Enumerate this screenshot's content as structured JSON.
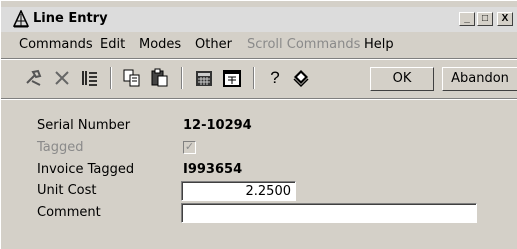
{
  "window": {
    "title": "Line Entry",
    "controls": {
      "minimize": "_",
      "maximize": "□",
      "close": "X"
    }
  },
  "menu": [
    "Commands",
    "Edit",
    "Modes",
    "Other",
    "Scroll Commands",
    "Help"
  ],
  "menu_disabled": [
    "Scroll Commands"
  ],
  "toolbar": {
    "icons": [
      "tools-icon",
      "delete-icon",
      "list-icon",
      "copy-icon",
      "paste-icon",
      "calculator-icon",
      "calendar-icon",
      "help-icon",
      "book-icon"
    ],
    "ok_label": "OK",
    "abandon_label": "Abandon"
  },
  "form": {
    "serial_number": {
      "label": "Serial Number",
      "value": "12-10294"
    },
    "tagged": {
      "label": "Tagged",
      "checked": true,
      "disabled": true
    },
    "invoice_tagged": {
      "label": "Invoice Tagged",
      "value": "I993654"
    },
    "unit_cost": {
      "label": "Unit Cost",
      "value": "2.2500"
    },
    "comment": {
      "label": "Comment",
      "value": ""
    }
  }
}
